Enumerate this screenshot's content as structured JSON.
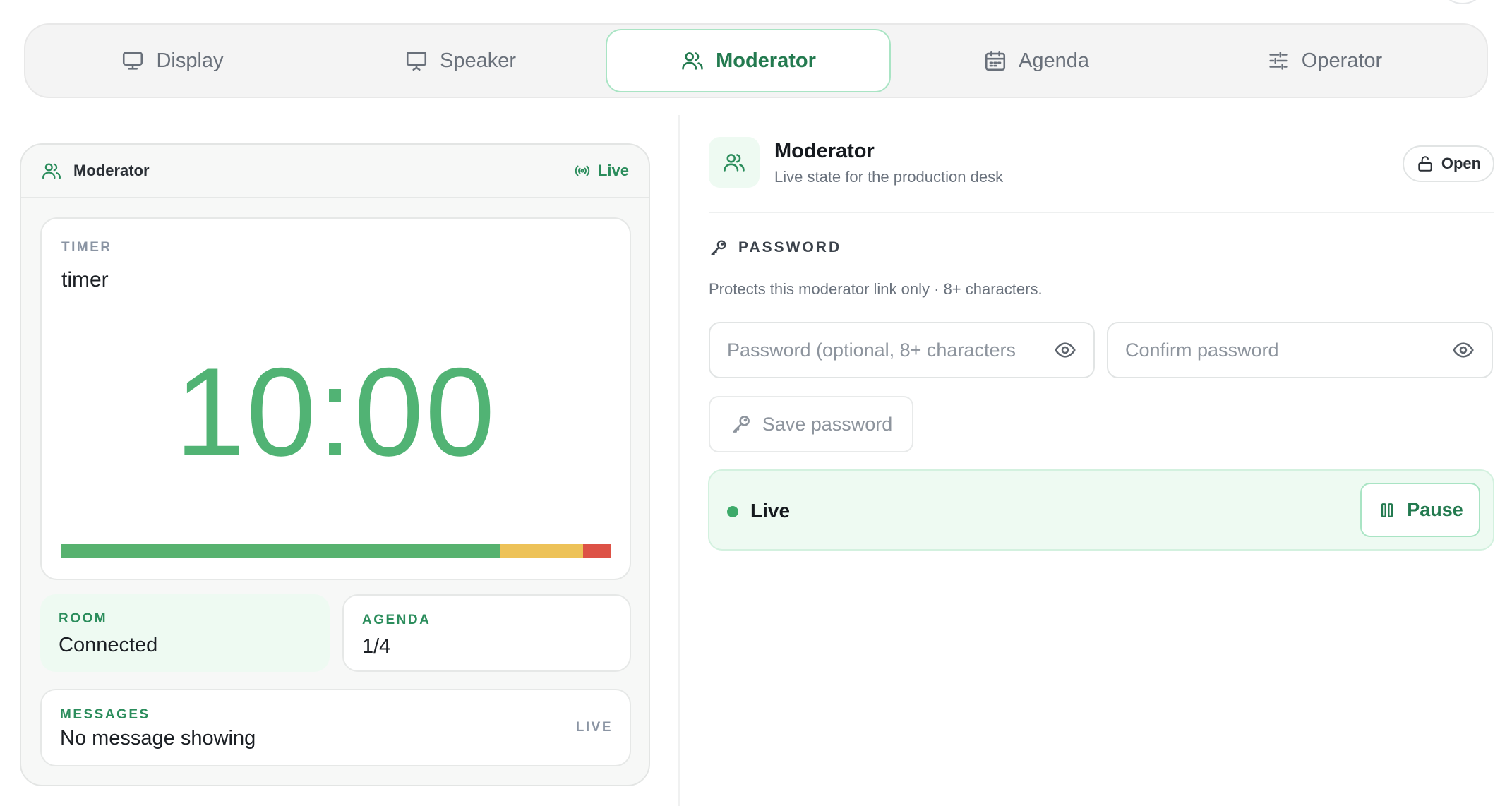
{
  "tabs": [
    {
      "label": "Display",
      "icon": "monitor-icon",
      "active": false
    },
    {
      "label": "Speaker",
      "icon": "presentation-icon",
      "active": false
    },
    {
      "label": "Moderator",
      "icon": "users-icon",
      "active": true
    },
    {
      "label": "Agenda",
      "icon": "calendar-icon",
      "active": false
    },
    {
      "label": "Operator",
      "icon": "sliders-icon",
      "active": false
    }
  ],
  "left_panel": {
    "title": "Moderator",
    "status": "Live",
    "timer": {
      "eyebrow": "TIMER",
      "name": "timer",
      "clock": "10:00",
      "progress_segments": [
        {
          "color": "#57b26f",
          "fraction": 0.8
        },
        {
          "color": "#edc258",
          "fraction": 0.15
        },
        {
          "color": "#dd5246",
          "fraction": 0.05
        }
      ]
    },
    "room": {
      "eyebrow": "ROOM",
      "value": "Connected"
    },
    "agenda": {
      "eyebrow": "AGENDA",
      "value": "1/4"
    },
    "messages": {
      "eyebrow": "MESSAGES",
      "value": "No message showing",
      "badge": "LIVE"
    }
  },
  "right_panel": {
    "title": "Moderator",
    "subtitle": "Live state for the production desk",
    "open_label": "Open",
    "password": {
      "heading": "PASSWORD",
      "description": "Protects this moderator link only · 8+ characters.",
      "field1_placeholder": "Password (optional, 8+ characters",
      "field2_placeholder": "Confirm password",
      "save_label": "Save password"
    },
    "live_status": {
      "label": "Live",
      "pause_label": "Pause"
    }
  },
  "colors": {
    "accent": "#2b8d5c",
    "timer_green": "#51b374",
    "soft_green_bg": "#eefaf2"
  }
}
